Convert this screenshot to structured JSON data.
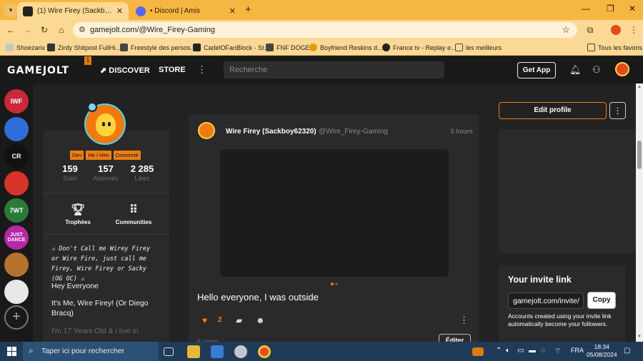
{
  "browser": {
    "tabs": [
      {
        "title": "(1) Wire Firey (Sackboy62320) | Game Jolt",
        "active": true
      },
      {
        "title": "• Discord | Amis",
        "active": false
      }
    ],
    "url": "gamejolt.com/@Wire_Firey-Gaming",
    "bookmarks": [
      "Shoezarix",
      "Zirdy Shitpost FullHi...",
      "Freestyle des persos...",
      "CadelOFanBlock - St...",
      "FNF DOGE",
      "Boyfriend Reskins d...",
      "France tv - Replay e...",
      "les meilleurs",
      "Tous les favoris"
    ]
  },
  "header": {
    "logo": "GAMEJOLT",
    "logo_badge": "1",
    "nav": [
      "DISCOVER",
      "STORE"
    ],
    "search_placeholder": "Recherche",
    "get_app": "Get App"
  },
  "rail": {
    "items": [
      {
        "label": "IWF",
        "color": "#c9283a"
      },
      {
        "label": "",
        "color": "#2f6ed8"
      },
      {
        "label": "CR",
        "color": "#111111"
      },
      {
        "label": "",
        "color": "#d8332a"
      },
      {
        "label": "7WT",
        "color": "#2c7a3a"
      },
      {
        "label": "JUST DANCE",
        "color": "#b42aa6"
      },
      {
        "label": "",
        "color": "#b5722e"
      },
      {
        "label": "",
        "color": "#e8e8e8"
      }
    ]
  },
  "profile": {
    "tags": [
      "Dev",
      "He / Him",
      "Connecté"
    ],
    "stats": [
      {
        "value": "159",
        "label": "Suivi"
      },
      {
        "value": "157",
        "label": "Abonnés"
      },
      {
        "value": "2 285",
        "label": "Likes"
      }
    ],
    "tiles": [
      "Trophées",
      "Communities"
    ],
    "bio_warning": "⚠ Don't Call me Wirey Firey or Wire Fire, just call me Firey, Wire Firey or Sacky (OG OC) ⚠",
    "bio_lines": [
      "Hey Everyone",
      "It's Me, Wire Firey! (Or Diego Bracq)",
      "I'm 17 Years Old & i live in"
    ],
    "edit_profile": "Edit profile"
  },
  "post": {
    "author": "Wire Firey (Sackboy62320)",
    "handle": "@Wire_Firey-Gaming",
    "time": "3 hours",
    "text": "Hello everyone, I was outside",
    "likes": "2",
    "views": "6 views",
    "edit": "Éditer"
  },
  "invite": {
    "title": "Your invite link",
    "link": "gamejolt.com/invite/",
    "copy": "Copy",
    "description": "Accounts created using your invite link automatically become your followers."
  },
  "taskbar": {
    "search": "Taper ici pour rechercher",
    "lang": "FRA",
    "time": "18:34",
    "date": "05/08/2024"
  },
  "colors": {
    "accent": "#ee7d14",
    "browser_chrome": "#f6b642"
  }
}
